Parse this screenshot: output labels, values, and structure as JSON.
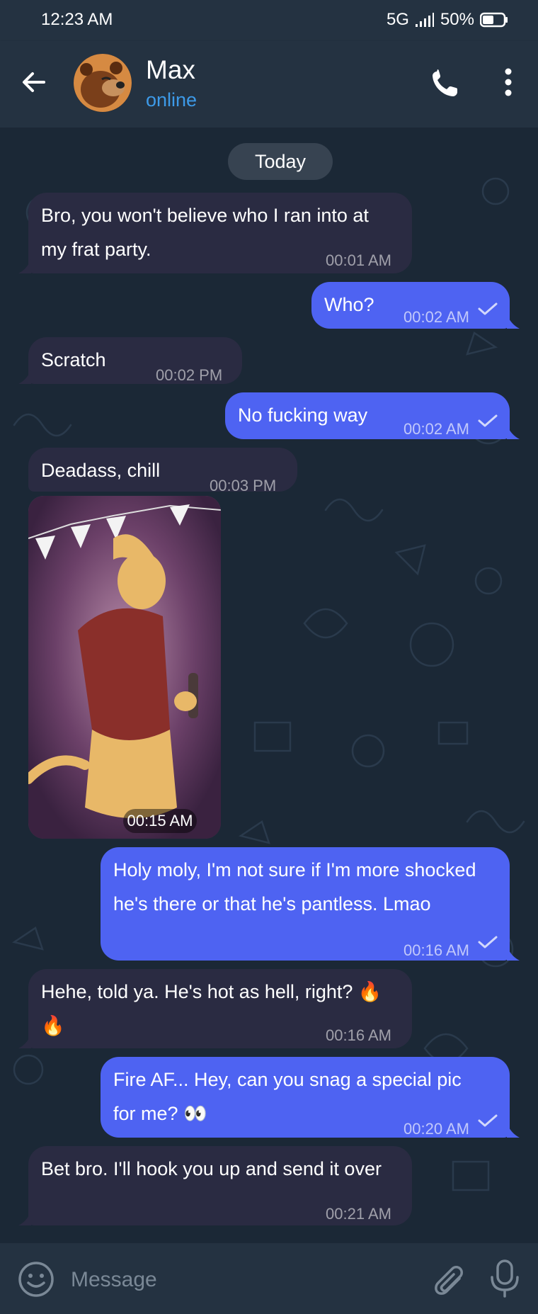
{
  "status_bar": {
    "time": "12:23 AM",
    "network": "5G",
    "battery": "50%"
  },
  "header": {
    "contact_name": "Max",
    "contact_status": "online"
  },
  "chat": {
    "date_label": "Today",
    "messages": [
      {
        "direction": "in",
        "text_line1": "Bro, you won't believe who I ran into at",
        "text_line2": "my frat party.",
        "time": "00:01 AM"
      },
      {
        "direction": "out",
        "text": "Who?",
        "time": "00:02 AM"
      },
      {
        "direction": "in",
        "text": "Scratch",
        "time": "00:02 PM"
      },
      {
        "direction": "out",
        "text": "No fucking way",
        "time": "00:02 AM"
      },
      {
        "direction": "in",
        "text": "Deadass, chill",
        "time": "00:03 PM"
      },
      {
        "direction": "in",
        "type": "photo",
        "time": "00:15 AM"
      },
      {
        "direction": "out",
        "text_line1": "Holy moly, I'm not sure if I'm more shocked",
        "text_line2": "he's there or that he's pantless. Lmao",
        "time": "00:16 AM"
      },
      {
        "direction": "in",
        "text_line1": "Hehe, told ya. He's hot as hell, right? 🔥",
        "text_line2": "🔥",
        "time": "00:16 AM"
      },
      {
        "direction": "out",
        "text_line1": "Fire AF... Hey, can you snag a special pic",
        "text_line2": "for me? 👀",
        "time": "00:20 AM"
      },
      {
        "direction": "in",
        "text": "Bet bro. I'll hook you up and send it over",
        "time": "00:21 AM"
      }
    ]
  },
  "composer": {
    "placeholder": "Message"
  },
  "colors": {
    "incoming_bubble": "#2a2b42",
    "outgoing_bubble": "#4e63f2",
    "accent_status": "#3d9ae8",
    "chat_background": "#1b2836"
  },
  "icons": {
    "back": "arrow-left-icon",
    "call": "phone-icon",
    "menu": "more-vertical-icon",
    "emoji": "smiley-icon",
    "attach": "paperclip-icon",
    "mic": "microphone-icon",
    "read": "check-icon"
  }
}
